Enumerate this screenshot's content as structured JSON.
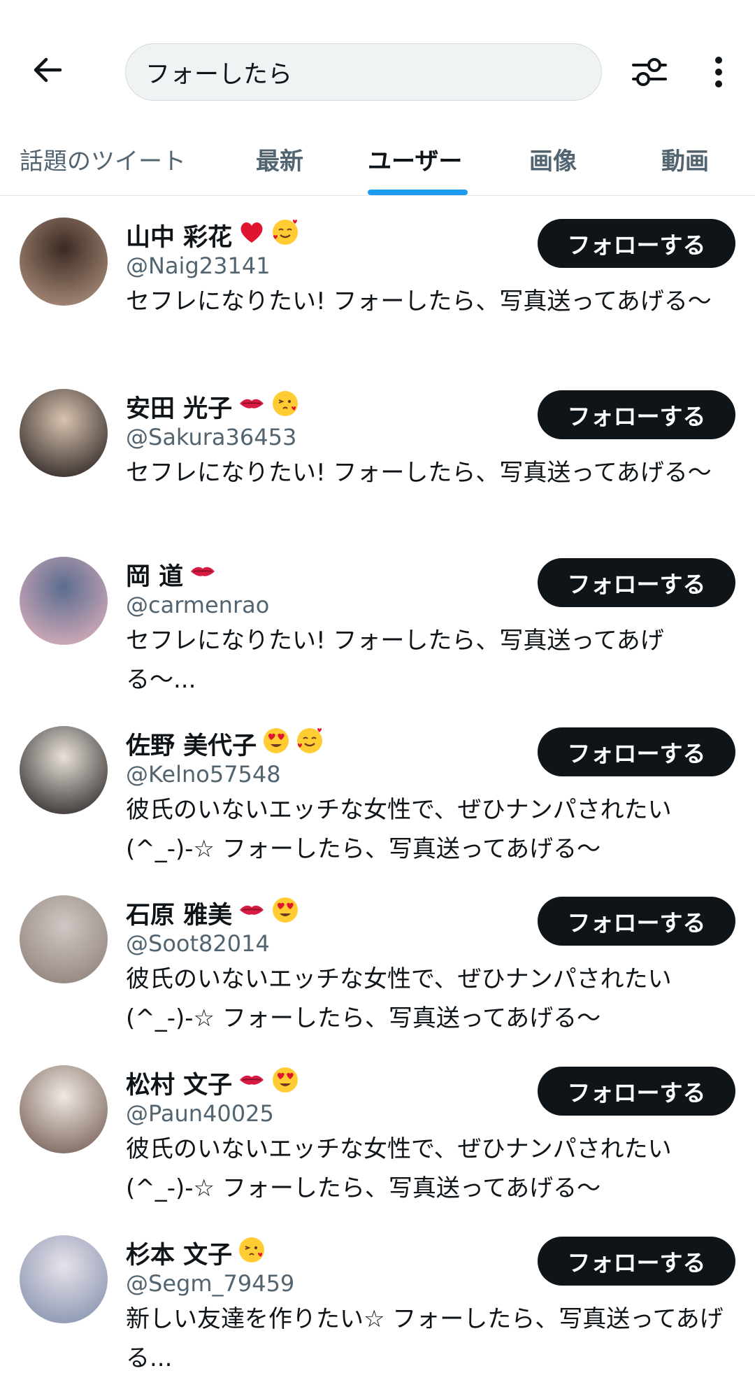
{
  "search": {
    "query": "フォーしたら"
  },
  "tabs": [
    {
      "label": "話題のツイート"
    },
    {
      "label": "最新"
    },
    {
      "label": "ユーザー"
    },
    {
      "label": "画像"
    },
    {
      "label": "動画"
    }
  ],
  "active_tab": "ユーザー",
  "follow_label": "フォローする",
  "users": [
    {
      "name": "山中 彩花",
      "handle": "@Naig23141",
      "bio": "セフレになりたい! フォーしたら、写真送ってあげる〜",
      "emojis": [
        "red-heart-icon",
        "smiling-face-with-hearts-icon"
      ]
    },
    {
      "name": "安田 光子",
      "handle": "@Sakura36453",
      "bio": "セフレになりたい! フォーしたら、写真送ってあげる〜",
      "emojis": [
        "kiss-mark-icon",
        "face-blowing-kiss-icon"
      ]
    },
    {
      "name": "岡 道",
      "handle": "@carmenrao",
      "bio": "セフレになりたい! フォーしたら、写真送ってあげる〜...",
      "emojis": [
        "kiss-mark-icon"
      ]
    },
    {
      "name": "佐野 美代子",
      "handle": "@Kelno57548",
      "bio": "彼氏のいないエッチな女性で、ぜひナンパされたい (^_-)-☆ フォーしたら、写真送ってあげる〜",
      "emojis": [
        "heart-eyes-icon",
        "smiling-face-with-hearts-icon"
      ]
    },
    {
      "name": "石原 雅美",
      "handle": "@Soot82014",
      "bio": "彼氏のいないエッチな女性で、ぜひナンパされたい (^_-)-☆ フォーしたら、写真送ってあげる〜",
      "emojis": [
        "kiss-mark-icon",
        "heart-eyes-icon"
      ]
    },
    {
      "name": "松村 文子",
      "handle": "@Paun40025",
      "bio": "彼氏のいないエッチな女性で、ぜひナンパされたい (^_-)-☆ フォーしたら、写真送ってあげる〜",
      "emojis": [
        "kiss-mark-icon",
        "heart-eyes-icon"
      ]
    },
    {
      "name": "杉本 文子",
      "handle": "@Segm_79459",
      "bio": "新しい友達を作りたい☆ フォーしたら、写真送ってあげる...",
      "emojis": [
        "face-blowing-kiss-icon"
      ]
    }
  ],
  "colors": {
    "accent": "#1d9bf0",
    "button_bg": "#0f1419",
    "secondary_text": "#536471"
  }
}
